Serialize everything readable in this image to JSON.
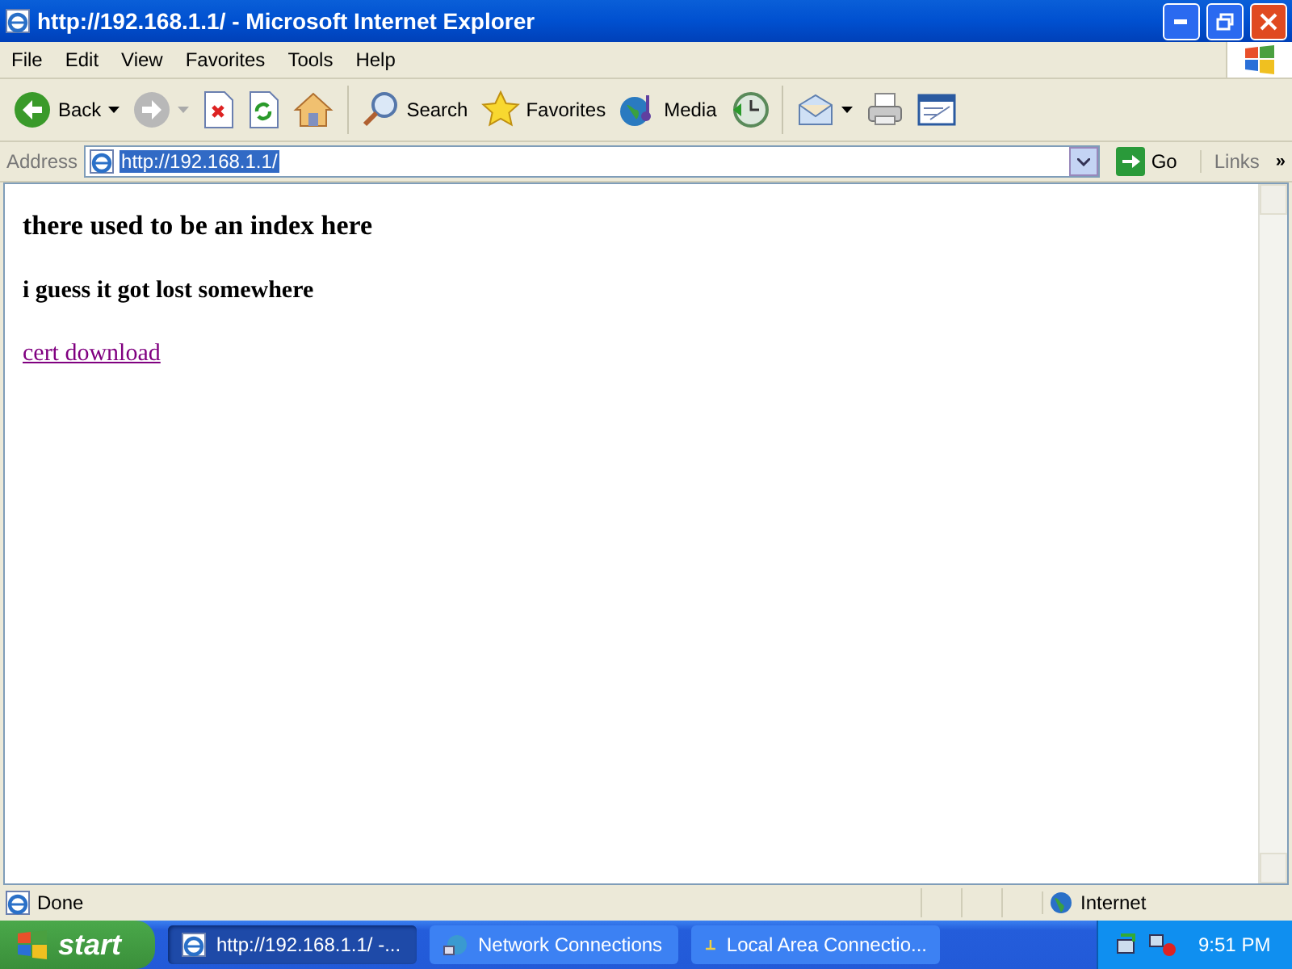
{
  "window": {
    "title": "http://192.168.1.1/ - Microsoft Internet Explorer"
  },
  "menu": [
    "File",
    "Edit",
    "View",
    "Favorites",
    "Tools",
    "Help"
  ],
  "toolbar": [
    {
      "kind": "back",
      "label": "Back",
      "dropdown": true
    },
    {
      "kind": "forward",
      "dropdown": true,
      "disabled": true
    },
    {
      "kind": "stop"
    },
    {
      "kind": "refresh"
    },
    {
      "kind": "home"
    },
    {
      "kind": "separator"
    },
    {
      "kind": "search",
      "label": "Search"
    },
    {
      "kind": "favorites",
      "label": "Favorites"
    },
    {
      "kind": "media",
      "label": "Media"
    },
    {
      "kind": "history"
    },
    {
      "kind": "separator"
    },
    {
      "kind": "mail",
      "dropdown": true
    },
    {
      "kind": "print"
    },
    {
      "kind": "edit"
    }
  ],
  "address": {
    "label": "Address",
    "value": "http://192.168.1.1/",
    "highlighted": true,
    "go": "Go",
    "links": "Links",
    "more": "»"
  },
  "page": {
    "heading": "there used to be an index here",
    "subheading": "i guess it got lost somewhere",
    "link": {
      "text": "cert download",
      "visited": true
    }
  },
  "status_bar": {
    "text": "Done",
    "zone": "Internet"
  },
  "taskbar": {
    "start": "start",
    "items": [
      {
        "label": "http://192.168.1.1/ -...",
        "kind": "ie",
        "selected": true
      },
      {
        "label": "Network Connections",
        "kind": "network",
        "selected": false
      },
      {
        "label": "Local Area Connectio...",
        "kind": "lan",
        "selected": false
      }
    ],
    "clock": "9:51 PM"
  }
}
